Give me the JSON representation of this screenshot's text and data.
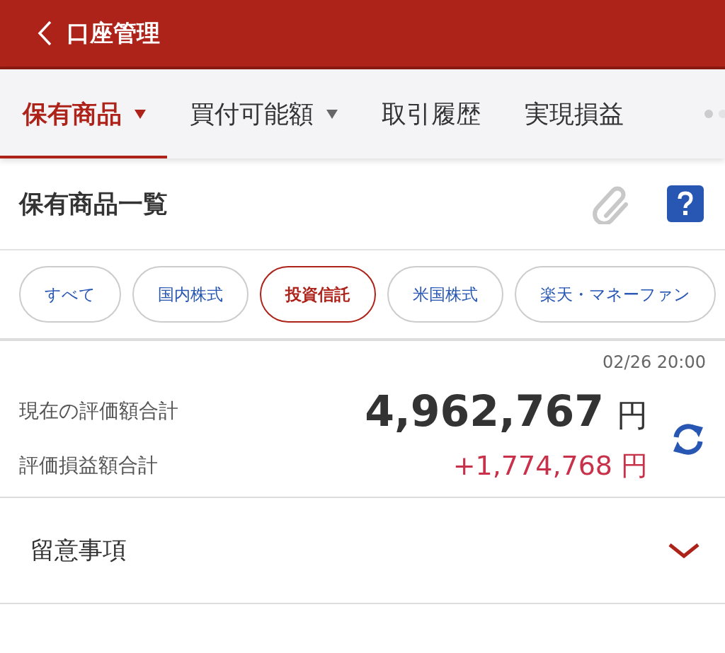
{
  "header": {
    "title": "口座管理"
  },
  "tabs": [
    {
      "label": "保有商品",
      "selected": true,
      "dropdown": true
    },
    {
      "label": "買付可能額",
      "selected": false,
      "dropdown": true
    },
    {
      "label": "取引履歴",
      "selected": false,
      "dropdown": false
    },
    {
      "label": "実現損益",
      "selected": false,
      "dropdown": false
    }
  ],
  "section": {
    "title": "保有商品一覧"
  },
  "filters": [
    {
      "label": "すべて",
      "selected": false
    },
    {
      "label": "国内株式",
      "selected": false
    },
    {
      "label": "投資信託",
      "selected": true
    },
    {
      "label": "米国株式",
      "selected": false
    },
    {
      "label": "楽天・マネーファン",
      "selected": false
    }
  ],
  "summary": {
    "timestamp": "02/26 20:00",
    "rows": [
      {
        "label": "現在の評価額合計",
        "value": "4,962,767",
        "unit": "円",
        "kind": "total"
      },
      {
        "label": "評価損益額合計",
        "value": "+1,774,768",
        "unit": "円",
        "kind": "gain"
      }
    ]
  },
  "notes": {
    "title": "留意事項",
    "expanded": false
  }
}
